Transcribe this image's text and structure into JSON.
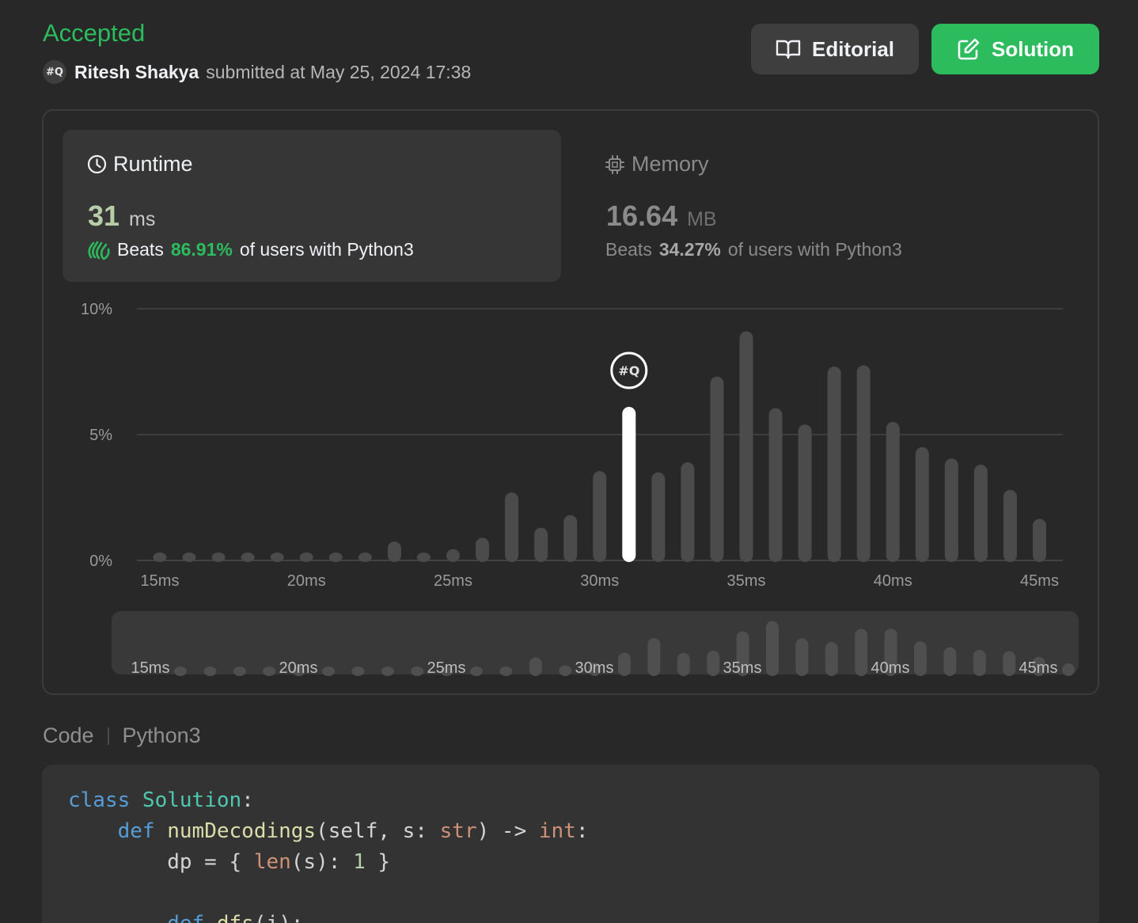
{
  "header": {
    "status": "Accepted",
    "avatar_text": "#Q",
    "user": "Ritesh Shakya",
    "submitted_text": "submitted at May 25, 2024 17:38"
  },
  "buttons": {
    "editorial": "Editorial",
    "solution": "Solution"
  },
  "stats": {
    "runtime": {
      "title": "Runtime",
      "value": "31",
      "unit": "ms",
      "beats_prefix": "Beats",
      "beats_pct": "86.91%",
      "beats_suffix": "of users with Python3"
    },
    "memory": {
      "title": "Memory",
      "value": "16.64",
      "unit": "MB",
      "beats_prefix": "Beats",
      "beats_pct": "34.27%",
      "beats_suffix": "of users with Python3"
    }
  },
  "chart_data": {
    "type": "bar",
    "x_ticks": [
      "15ms",
      "20ms",
      "25ms",
      "30ms",
      "35ms",
      "40ms",
      "45ms"
    ],
    "y_ticks": [
      "10%",
      "5%",
      "0%"
    ],
    "ylim": [
      0,
      10
    ],
    "x": [
      15,
      16,
      17,
      18,
      19,
      20,
      21,
      22,
      23,
      24,
      25,
      26,
      27,
      28,
      29,
      30,
      31,
      32,
      33,
      34,
      35,
      36,
      37,
      38,
      39,
      40,
      41,
      42,
      43,
      44,
      45
    ],
    "values": [
      0.3,
      0.3,
      0.3,
      0.3,
      0.3,
      0.3,
      0.3,
      0.3,
      0.75,
      0.3,
      0.45,
      0.9,
      2.7,
      1.3,
      1.8,
      3.55,
      6.1,
      3.5,
      3.9,
      7.3,
      9.1,
      6.05,
      5.4,
      7.7,
      7.75,
      5.5,
      4.5,
      4.05,
      3.8,
      2.8,
      1.65
    ],
    "highlight_x": 31,
    "highlight_avatar": "#Q",
    "grid": true
  },
  "code": {
    "tab_code": "Code",
    "tab_lang": "Python3",
    "lines": [
      [
        {
          "t": "class ",
          "c": "kw"
        },
        {
          "t": "Solution",
          "c": "cls"
        },
        {
          "t": ":",
          "c": ""
        }
      ],
      [
        {
          "t": "    ",
          "c": ""
        },
        {
          "t": "def ",
          "c": "kw"
        },
        {
          "t": "numDecodings",
          "c": "fn"
        },
        {
          "t": "(self, s: ",
          "c": ""
        },
        {
          "t": "str",
          "c": "bi"
        },
        {
          "t": ") -> ",
          "c": ""
        },
        {
          "t": "int",
          "c": "bi"
        },
        {
          "t": ":",
          "c": ""
        }
      ],
      [
        {
          "t": "        dp = { ",
          "c": ""
        },
        {
          "t": "len",
          "c": "bi"
        },
        {
          "t": "(s): ",
          "c": ""
        },
        {
          "t": "1",
          "c": "num"
        },
        {
          "t": " }",
          "c": ""
        }
      ],
      [
        {
          "t": "",
          "c": ""
        }
      ],
      [
        {
          "t": "        ",
          "c": ""
        },
        {
          "t": "def ",
          "c": "kw"
        },
        {
          "t": "dfs",
          "c": "fn"
        },
        {
          "t": "(i):",
          "c": ""
        }
      ]
    ]
  }
}
